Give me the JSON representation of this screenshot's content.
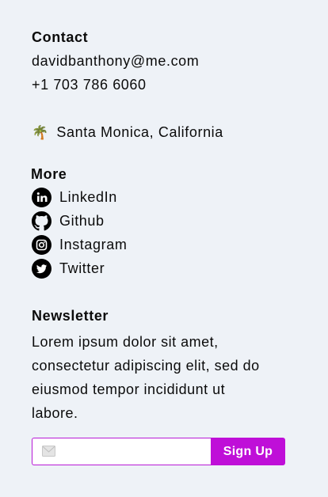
{
  "contact": {
    "heading": "Contact",
    "email": "davidbanthony@me.com",
    "phone": "+1 703 786 6060",
    "location_icon": "palm-tree-emoji",
    "location_glyph": "🌴",
    "location": "Santa Monica, California"
  },
  "more": {
    "heading": "More",
    "links": [
      {
        "label": "LinkedIn",
        "icon": "linkedin-icon"
      },
      {
        "label": "Github",
        "icon": "github-icon"
      },
      {
        "label": "Instagram",
        "icon": "instagram-icon"
      },
      {
        "label": "Twitter",
        "icon": "twitter-icon"
      }
    ]
  },
  "newsletter": {
    "heading": "Newsletter",
    "description": "Lorem ipsum dolor sit amet, consectetur adipiscing elit, sed do eiusmod tempor incididunt ut labore.",
    "email_value": "",
    "email_placeholder": "",
    "email_icon": "mail-icon",
    "button_label": "Sign Up"
  },
  "colors": {
    "background": "#eef2f7",
    "accent": "#bf0fd8",
    "text": "#0b0b0b"
  }
}
